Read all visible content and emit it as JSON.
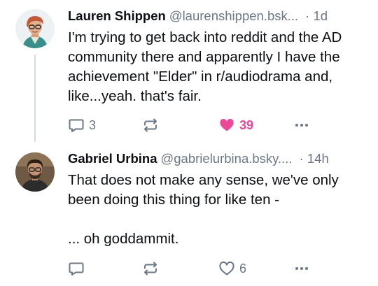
{
  "posts": [
    {
      "author_name": "Lauren Shippen",
      "author_handle": "@laurenshippen.bsk...",
      "time": "· 1d",
      "text_lines": [
        "I'm trying to get back into reddit and the AD community there and apparently I have the achievement \"Elder\" in r/audiodrama and, like...yeah. that's fair."
      ],
      "reply_count": "3",
      "repost_count": "",
      "like_count": "39",
      "liked": true
    },
    {
      "author_name": "Gabriel Urbina",
      "author_handle": "@gabrielurbina.bsky....",
      "time": "· 14h",
      "text_lines": [
        "That does not make any sense, we've only been doing this thing for like ten -",
        "... oh goddammit."
      ],
      "reply_count": "",
      "repost_count": "",
      "like_count": "6",
      "liked": false
    }
  ],
  "colors": {
    "text": "#0b0f14",
    "muted": "#6b7785",
    "like_active": "#ec4899",
    "thread_line": "#d4dbe2"
  },
  "icons": {
    "reply": "speech-bubble-icon",
    "repost": "repost-arrows-icon",
    "like": "heart-icon",
    "more": "ellipsis-icon"
  }
}
